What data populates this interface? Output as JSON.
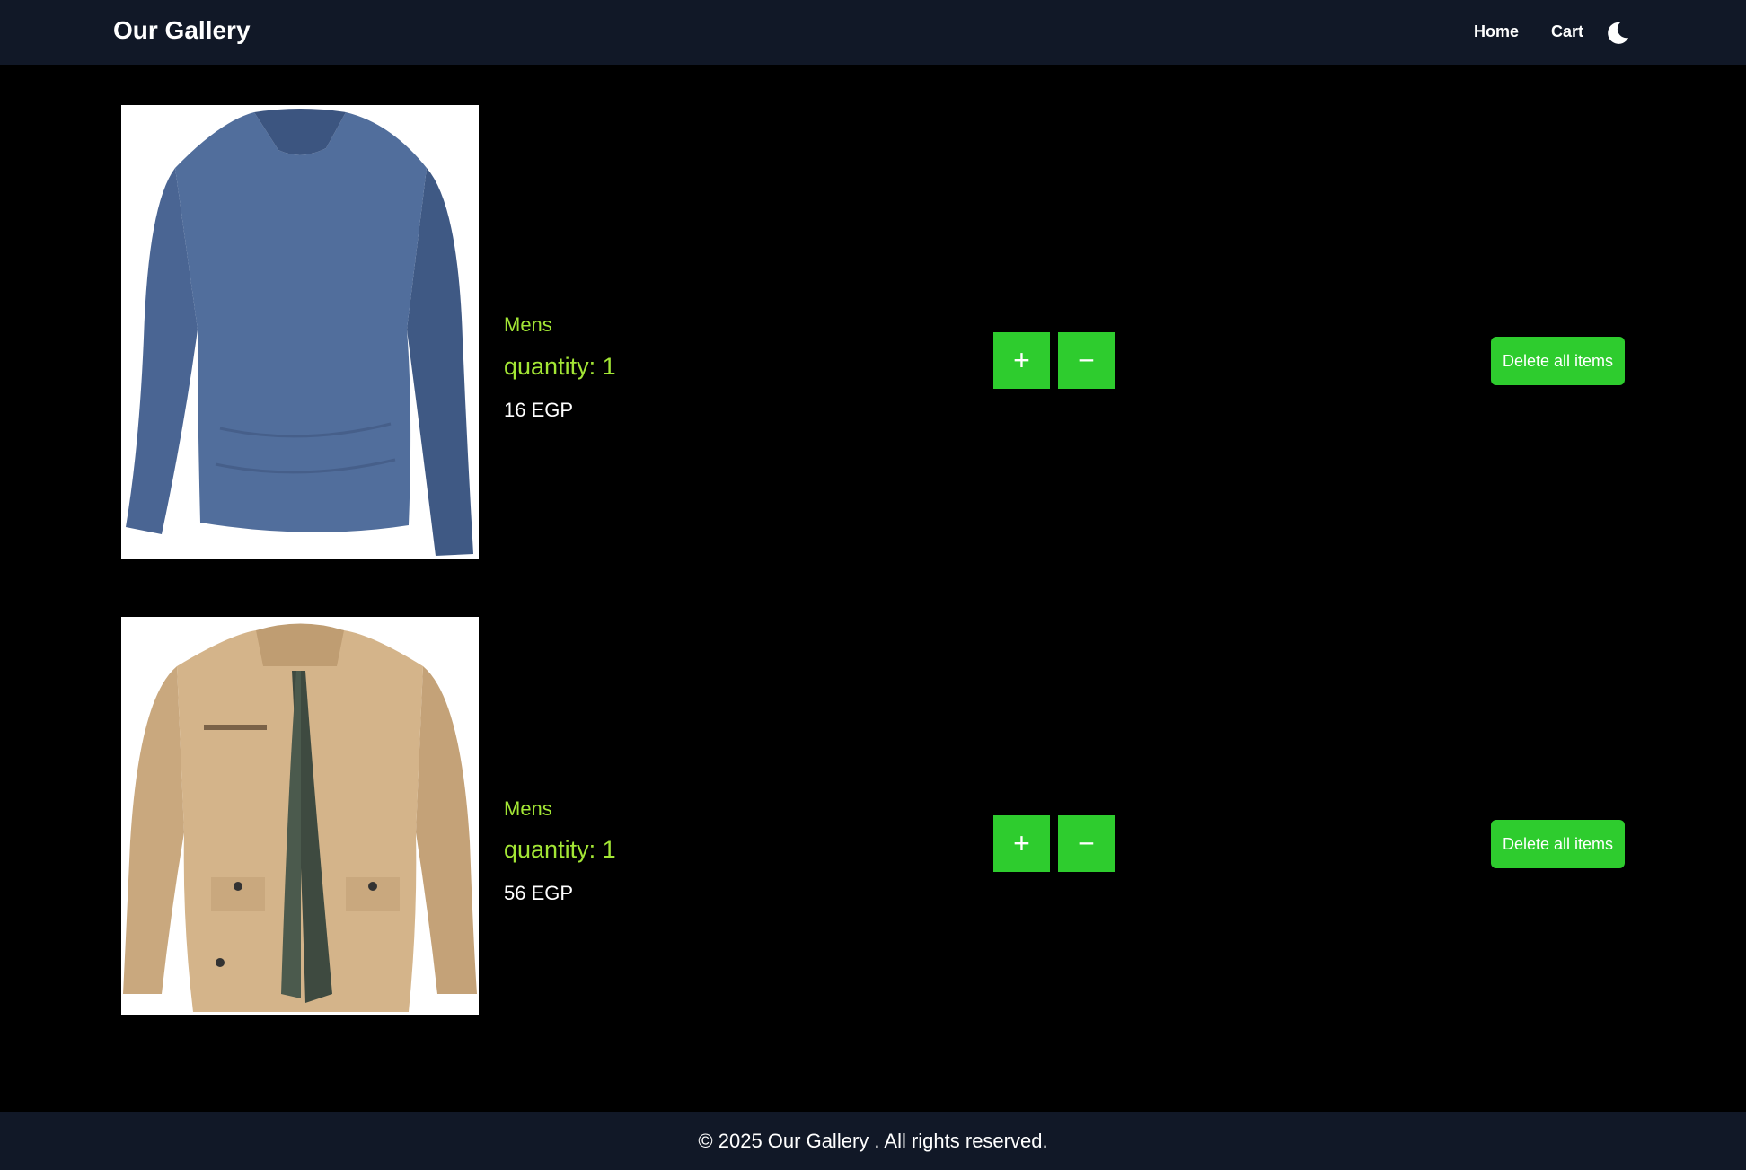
{
  "header": {
    "brand": "Our Gallery",
    "nav": {
      "home": "Home",
      "cart": "Cart"
    },
    "theme_icon": "moon-icon"
  },
  "cart": {
    "items": [
      {
        "image_icon": "long-sleeve-shirt-image",
        "category": "Mens",
        "quantity_text": "quantity: 1",
        "price": "16 EGP",
        "plus_label": "+",
        "minus_label": "−",
        "delete_label": "Delete all items"
      },
      {
        "image_icon": "jacket-image",
        "category": "Mens",
        "quantity_text": "quantity: 1",
        "price": "56 EGP",
        "plus_label": "+",
        "minus_label": "−",
        "delete_label": "Delete all items"
      }
    ]
  },
  "footer": {
    "text": "© 2025 Our Gallery . All rights reserved."
  },
  "colors": {
    "nav_bg": "#111827",
    "page_bg": "#000000",
    "accent_green": "#2ecc2e",
    "label_lime": "#a3e635"
  }
}
